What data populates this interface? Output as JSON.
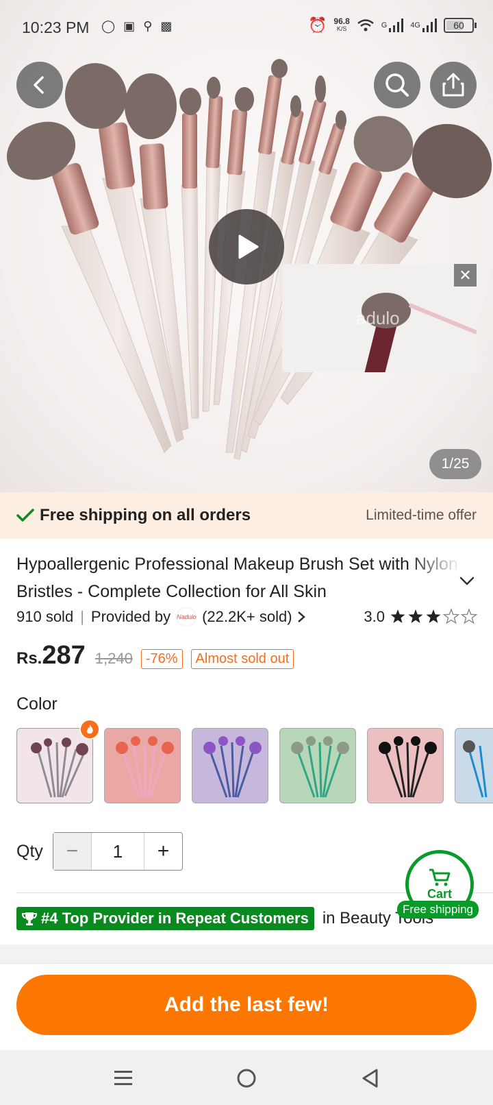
{
  "status_bar": {
    "time": "10:23 PM",
    "net_speed": "96.8",
    "net_unit": "K/S",
    "signal1": "G",
    "signal2": "4G",
    "battery": "60"
  },
  "gallery": {
    "counter": "1/25",
    "video_overlay_text": "adulo"
  },
  "shipping_banner": {
    "text": "Free shipping on all orders",
    "offer": "Limited-time offer"
  },
  "product": {
    "title": "Hypoallergenic Professional Makeup Brush Set with Nylon Bristles - Complete Collection for All Skin",
    "sold": "910 sold",
    "provided_by": "Provided by",
    "store_logo_text": "Nadulo",
    "store_sold": "(22.2K+ sold)",
    "rating": "3.0",
    "rating_stars": 3,
    "currency": "Rs.",
    "price": "287",
    "old_price": "1,240",
    "discount": "-76%",
    "stock_tag": "Almost sold out"
  },
  "color": {
    "label": "Color",
    "options": [
      "rose-silver",
      "pink",
      "purple-blue",
      "green",
      "black-silver",
      "blue"
    ]
  },
  "quantity": {
    "label": "Qty",
    "value": "1",
    "minus": "−",
    "plus": "+"
  },
  "badge": {
    "text": "#4 Top Provider in Repeat Customers",
    "after": "in Beauty Tools"
  },
  "cart": {
    "label": "Cart",
    "ship": "Free shipping"
  },
  "cta": {
    "label": "Add the last few!"
  },
  "colors": {
    "accent": "#fb7701",
    "green": "#0a8a1e",
    "banner_bg": "#fdeee3"
  }
}
